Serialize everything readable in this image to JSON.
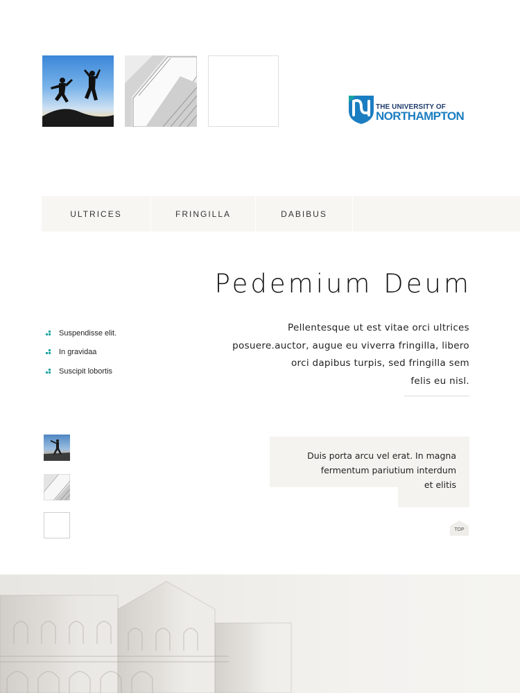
{
  "gallery": {
    "thumbnails": [
      "photo-jumpers",
      "photo-building",
      "photo-blank"
    ]
  },
  "logo": {
    "line1": "THE UNIVERSITY OF",
    "line2": "NORTHAMPTON",
    "colors": {
      "mark": "#1b7dc1",
      "text_dark": "#1d3a6b",
      "accent": "#18a3a0"
    }
  },
  "nav": {
    "items": [
      {
        "label": "ULTRICES"
      },
      {
        "label": "FRINGILLA"
      },
      {
        "label": "DABIBUS"
      }
    ]
  },
  "main": {
    "title": "Pedemium Deum",
    "paragraph_lines": [
      "Pellentesque ut est vitae orci ultrices",
      "posuere.auctor, augue eu viverra fringilla, libero",
      "orci dapibus turpis, sed fringilla sem",
      "felis eu nisl."
    ],
    "quote_lines": [
      "Duis porta arcu vel erat. In magna",
      "fermentum pariutium interdum",
      "et elitis"
    ]
  },
  "sidebar": {
    "items": [
      {
        "label": "Suspendisse elit.",
        "icon": "bullet-icon"
      },
      {
        "label": "In gravidaa",
        "icon": "bullet-icon"
      },
      {
        "label": "Suscipit lobortis",
        "icon": "bullet-icon"
      }
    ]
  },
  "small_gallery": [
    "photo-dancer",
    "photo-building",
    "photo-blank"
  ],
  "top_button": {
    "label": "TOP"
  }
}
